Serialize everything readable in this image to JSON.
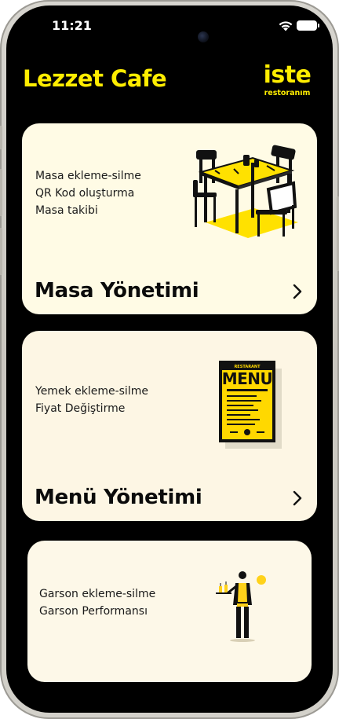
{
  "status_bar": {
    "time": "11:21"
  },
  "header": {
    "app_title": "Lezzet Cafe",
    "logo_main": "iste",
    "logo_sub": "restoranım"
  },
  "cards": [
    {
      "title": "Masa Yönetimi",
      "features": [
        "Masa ekleme-silme",
        "QR Kod oluşturma",
        "Masa takibi"
      ],
      "illustration": "table-chairs-icon"
    },
    {
      "title": "Menü Yönetimi",
      "features": [
        "Yemek ekleme-silme",
        "Fiyat Değiştirme"
      ],
      "illustration": "menu-board-icon",
      "menu_board_text": "MENU",
      "menu_board_header": "RESTARANT"
    },
    {
      "title": "",
      "features": [
        "Garson ekleme-silme",
        "Garson Performansı"
      ],
      "illustration": "waiter-icon"
    }
  ],
  "colors": {
    "accent": "#ffed00",
    "background": "#000000",
    "card": "#fffbe5",
    "text": "#0b0b0b"
  }
}
